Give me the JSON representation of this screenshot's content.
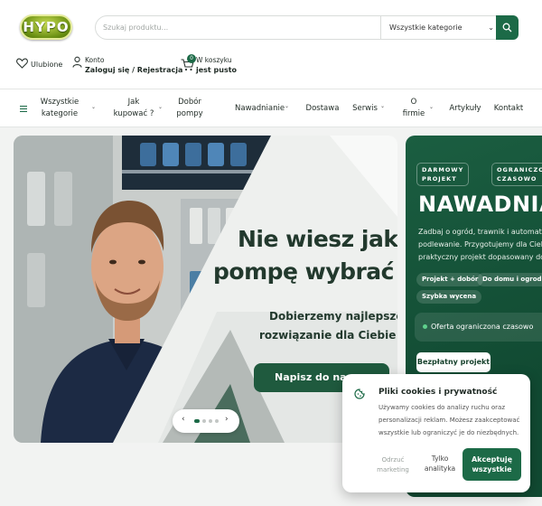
{
  "brand": {
    "logo_text": "HYPO",
    "accent": "#1c6a47"
  },
  "search": {
    "placeholder": "Szukaj produktu...",
    "category_selected": "Wszystkie kategorie"
  },
  "user_bar": {
    "favorites": "Ulubione",
    "account_line1": "Konto",
    "account_line2": "Zaloguj się / Rejestracja",
    "cart_count": "0",
    "cart_line1": "W koszyku",
    "cart_line2": "jest pusto"
  },
  "nav": {
    "all_categories_1": "Wszystkie",
    "all_categories_2": "kategorie",
    "how_to_buy_1": "Jak",
    "how_to_buy_2": "kupować ?",
    "pump_choice_1": "Dobór",
    "pump_choice_2": "pompy",
    "irrigation": "Nawadnianie",
    "delivery": "Dostawa",
    "service": "Serwis",
    "about_1": "O",
    "about_2": "firmie",
    "articles": "Artykuły",
    "contact": "Kontakt"
  },
  "hero": {
    "title_line1": "Nie wiesz jaką",
    "title_line2": "pompę wybrać ?",
    "subtitle_line1": "Dobierzemy najlepsze",
    "subtitle_line2": "rozwiązanie dla Ciebie !",
    "cta": "Napisz do nas",
    "prev": "‹",
    "next": "›"
  },
  "promo": {
    "chip1_line1": "DARMOWY",
    "chip1_line2": "PROJEKT",
    "chip2_line1": "OGRANICZON",
    "chip2_line2": "CZASOWO",
    "title": "NAWADNIA",
    "desc_line1": "Zadbaj o ogród, trawnik i automatyc",
    "desc_line2": "podlewanie. Przygotujemy dla Ciebie",
    "desc_line3": "praktyczny projekt dopasowany do p",
    "tag1": "Projekt + dobór",
    "tag2": "Do domu i ogrodu",
    "tag3": "Szybka wycena",
    "offer": "Oferta ograniczona czasowo",
    "button": "Bezpłatny projekt"
  },
  "cookie": {
    "title": "Pliki cookies i prywatność",
    "body_line1": "Używamy cookies do analizy ruchu oraz",
    "body_line2": "personalizacji reklam. Możesz zaakceptować",
    "body_line3": "wszystkie lub ograniczyć je do niezbędnych.",
    "reject_line1": "Odrzuć",
    "reject_line2": "marketing",
    "analytics_line1": "Tylko",
    "analytics_line2": "analityka",
    "accept_line1": "Akceptuję",
    "accept_line2": "wszystkie"
  },
  "icons": [
    "heart-icon",
    "user-icon",
    "cart-icon",
    "search-icon",
    "menu-icon",
    "chevron-down-icon",
    "cookie-icon"
  ]
}
